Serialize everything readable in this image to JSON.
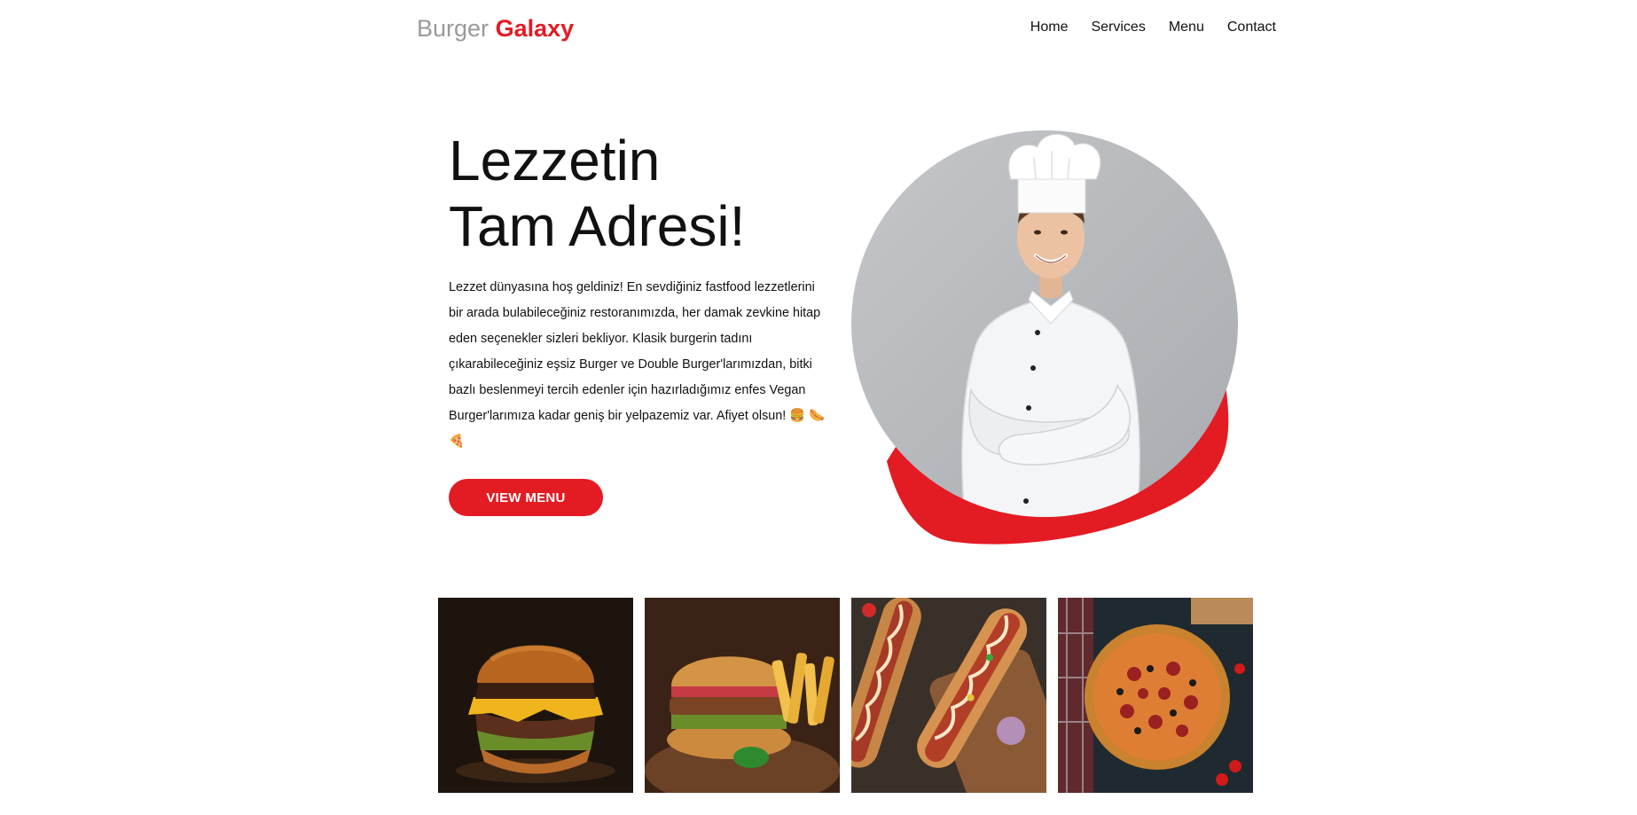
{
  "brand": {
    "part1": "Burger",
    "part2": "Galaxy"
  },
  "nav": {
    "items": [
      "Home",
      "Services",
      "Menu",
      "Contact"
    ]
  },
  "hero": {
    "title_line1": "Lezzetin",
    "title_line2": "Tam Adresi!",
    "text": "Lezzet dünyasına hoş geldiniz! En sevdiğiniz fastfood lezzetlerini bir arada bulabileceğiniz restoranımızda, her damak zevkine hitap eden seçenekler sizleri bekliyor. Klasik burgerin tadını çıkarabileceğiniz eşsiz Burger ve Double Burger'larımızdan, bitki bazlı beslenmeyi tercih edenler için hazırladığımız enfes Vegan Burger'larımıza kadar geniş bir yelpazemiz var. Afiyet olsun! 🍔 🌭 🍕",
    "button": "VIEW MENU"
  },
  "colors": {
    "accent": "#e31b23",
    "logo_gray": "#9a9a9a",
    "text": "#111111"
  },
  "gallery": [
    {
      "icon": "burger-photo"
    },
    {
      "icon": "burger-fries-photo"
    },
    {
      "icon": "hotdog-photo"
    },
    {
      "icon": "pizza-photo"
    }
  ]
}
